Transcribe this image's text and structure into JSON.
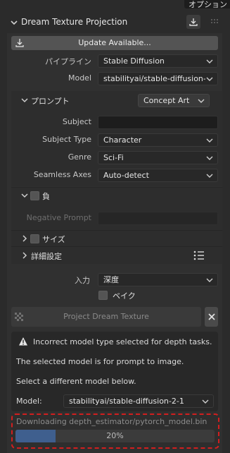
{
  "top_tab": {
    "label": "オプション"
  },
  "panel": {
    "title": "Dream Texture Projection",
    "update_button": "Update Available..."
  },
  "pipeline": {
    "label": "パイプライン",
    "value": "Stable Diffusion"
  },
  "model": {
    "label": "Model",
    "value": "stabilityai/stable-diffusion-..."
  },
  "prompt_section": {
    "label": "プロンプト",
    "preset": "Concept Art"
  },
  "subject": {
    "label": "Subject",
    "value": ""
  },
  "subject_type": {
    "label": "Subject Type",
    "value": "Character"
  },
  "genre": {
    "label": "Genre",
    "value": "Sci-Fi"
  },
  "seamless": {
    "label": "Seamless Axes",
    "value": "Auto-detect"
  },
  "negative_section": {
    "label": "負",
    "checked": false
  },
  "negative_prompt": {
    "label": "Negative Prompt",
    "value": ""
  },
  "size_section": {
    "label": "サイズ",
    "checked": false
  },
  "advanced_section": {
    "label": "詳細設定"
  },
  "input": {
    "label": "入力",
    "value": "深度"
  },
  "bake": {
    "label": "ベイク",
    "checked": false
  },
  "project_button": "Project Dream Texture",
  "warning": {
    "line1": "Incorrect model type selected for depth tasks.",
    "line2": "The selected model is for prompt to image.",
    "line3": "Select a different model below.",
    "model_label": "Model:",
    "model_value": "stabilityai/stable-diffusion-2-1"
  },
  "download": {
    "text": "Downloading depth_estimator/pytorch_model.bin",
    "progress_label": "20%",
    "progress": 0.2
  },
  "colors": {
    "accent_progress": "#3f5f8e",
    "highlight_dash": "#d21e1e"
  }
}
